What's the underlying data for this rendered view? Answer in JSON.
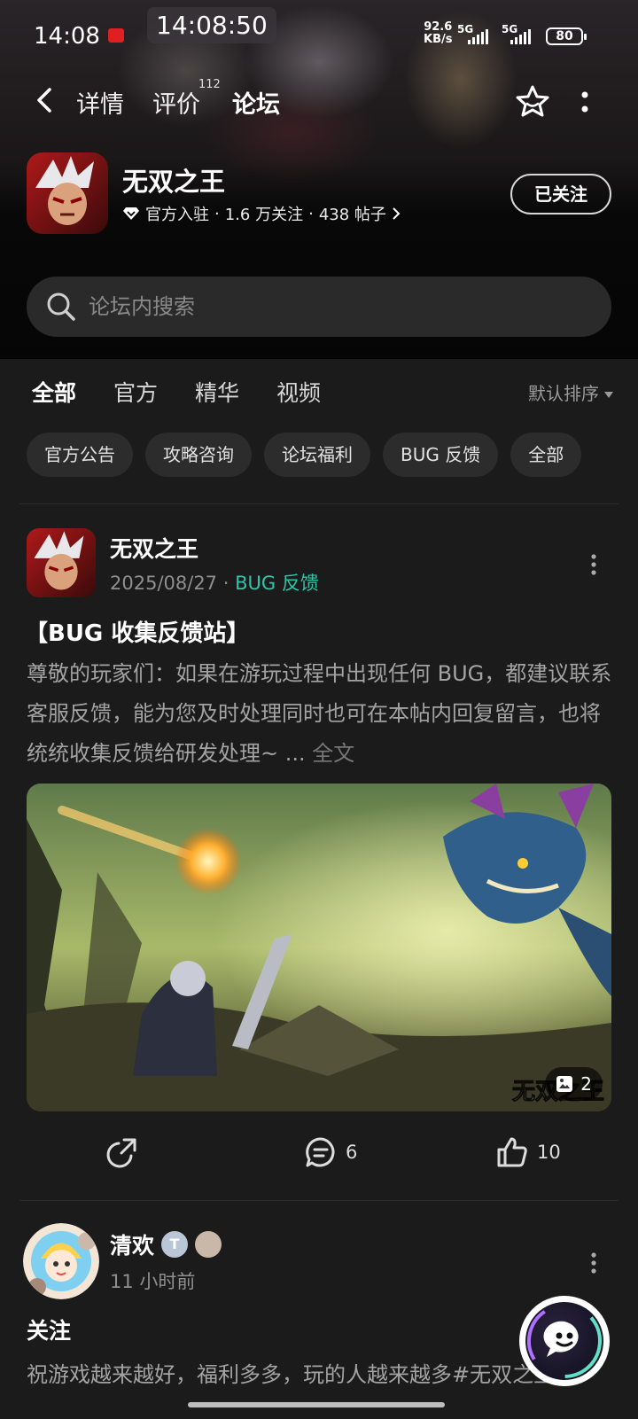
{
  "status_bar": {
    "time": "14:08",
    "clock_overlay": "14:08:50",
    "net_speed_value": "92.6",
    "net_speed_unit": "KB/s",
    "signal_1": "5G",
    "signal_2": "5G",
    "battery": "80"
  },
  "nav": {
    "tabs": [
      {
        "label": "详情"
      },
      {
        "label": "评价",
        "badge": "112"
      },
      {
        "label": "论坛",
        "active": true
      }
    ]
  },
  "game": {
    "name": "无双之王",
    "official": "官方入驻",
    "followers": "1.6 万关注",
    "posts": "438 帖子",
    "follow_button": "已关注"
  },
  "search": {
    "placeholder": "论坛内搜索"
  },
  "category_tabs": [
    "全部",
    "官方",
    "精华",
    "视频"
  ],
  "sort_label": "默认排序",
  "chips": [
    "官方公告",
    "攻略咨询",
    "论坛福利",
    "BUG 反馈",
    "全部"
  ],
  "post1": {
    "author": "无双之王",
    "date": "2025/08/27",
    "tag": "BUG 反馈",
    "title": "【BUG 收集反馈站】",
    "body": "尊敬的玩家们：如果在游玩过程中出现任何 BUG，都建议联系客服反馈，能为您及时处理同时也可在本帖内回复留言，也将统统收集反馈给研发处理~ ...",
    "full_text": "全文",
    "image_count": "2",
    "image_watermark": "无双之王",
    "comments": "6",
    "likes": "10"
  },
  "post2": {
    "author": "清欢",
    "badge_letter": "T",
    "time": "11 小时前",
    "title": "关注",
    "body": "祝游戏越来越好，福利多多，玩的人越来越多#无双之王"
  },
  "colors": {
    "accent": "#2fc5a8",
    "background": "#1b1b1b",
    "chip_bg": "#2c2c2c"
  }
}
